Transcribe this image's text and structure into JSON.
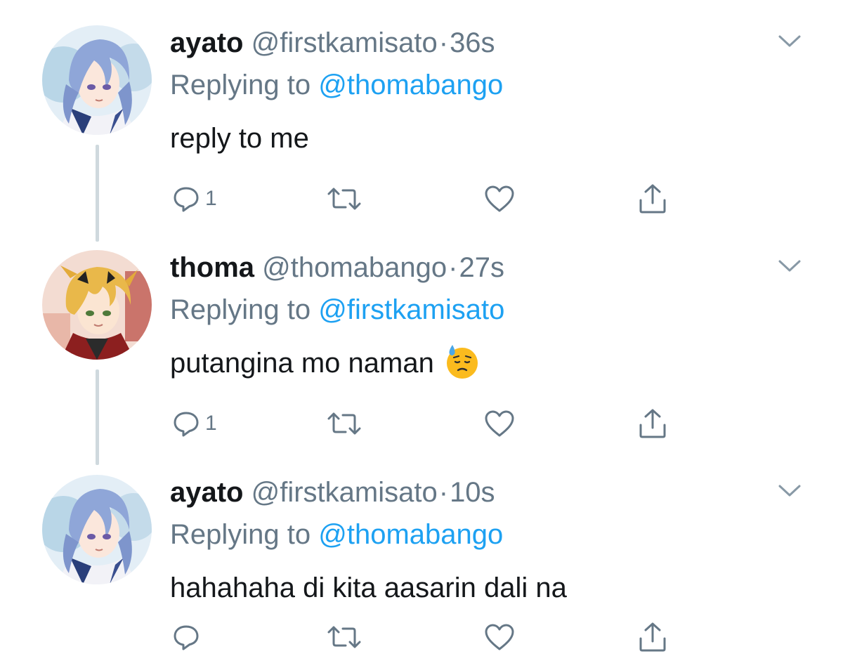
{
  "tweets": [
    {
      "name": "ayato",
      "handle": "@firstkamisato",
      "separator": "·",
      "time": "36s",
      "replying_prefix": "Replying to",
      "replying_to": "@thomabango",
      "text": "reply to me",
      "emoji": "",
      "reply_count": "1",
      "avatar": "ayato-avatar"
    },
    {
      "name": "thoma",
      "handle": "@thomabango",
      "separator": "·",
      "time": "27s",
      "replying_prefix": "Replying to",
      "replying_to": "@firstkamisato",
      "text": "putangina mo naman",
      "emoji": "downcast-face-with-sweat",
      "reply_count": "1",
      "avatar": "thoma-avatar"
    },
    {
      "name": "ayato",
      "handle": "@firstkamisato",
      "separator": "·",
      "time": "10s",
      "replying_prefix": "Replying to",
      "replying_to": "@thomabango",
      "text": "hahahaha di kita aasarin dali na",
      "emoji": "",
      "reply_count": "",
      "avatar": "ayato-avatar"
    }
  ],
  "icons": {
    "reply": "reply-icon",
    "retweet": "retweet-icon",
    "like": "heart-icon",
    "share": "share-icon",
    "more": "chevron-down-icon"
  },
  "colors": {
    "text": "#14171a",
    "secondary": "#657786",
    "link": "#1da1f2",
    "thread_line": "#cfd9de"
  }
}
